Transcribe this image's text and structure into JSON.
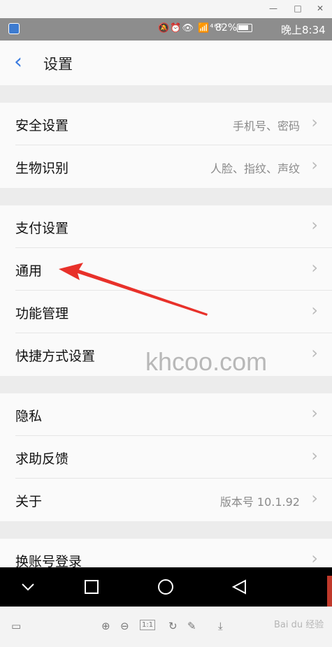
{
  "statusbar": {
    "indicators": "🔕⏰👁 📶⁴⁶ᴳ",
    "battery": "82%",
    "time": "晚上8:34"
  },
  "header": {
    "title": "设置"
  },
  "sections": [
    {
      "rows": [
        {
          "label": "安全设置",
          "value": "手机号、密码"
        },
        {
          "label": "生物识别",
          "value": "人脸、指纹、声纹"
        }
      ]
    },
    {
      "rows": [
        {
          "label": "支付设置",
          "value": ""
        },
        {
          "label": "通用",
          "value": ""
        },
        {
          "label": "功能管理",
          "value": ""
        },
        {
          "label": "快捷方式设置",
          "value": ""
        }
      ]
    },
    {
      "rows": [
        {
          "label": "隐私",
          "value": ""
        },
        {
          "label": "求助反馈",
          "value": ""
        },
        {
          "label": "关于",
          "value": "版本号 10.1.92"
        }
      ]
    },
    {
      "rows": [
        {
          "label": "换账号登录",
          "value": ""
        }
      ]
    }
  ],
  "watermark": "khcoo.com",
  "annotation_color": "#e8312a",
  "accent_color": "#3a7be0",
  "toolbar": {
    "zoom_actual": "1:1",
    "source": "Bai du 经验"
  }
}
